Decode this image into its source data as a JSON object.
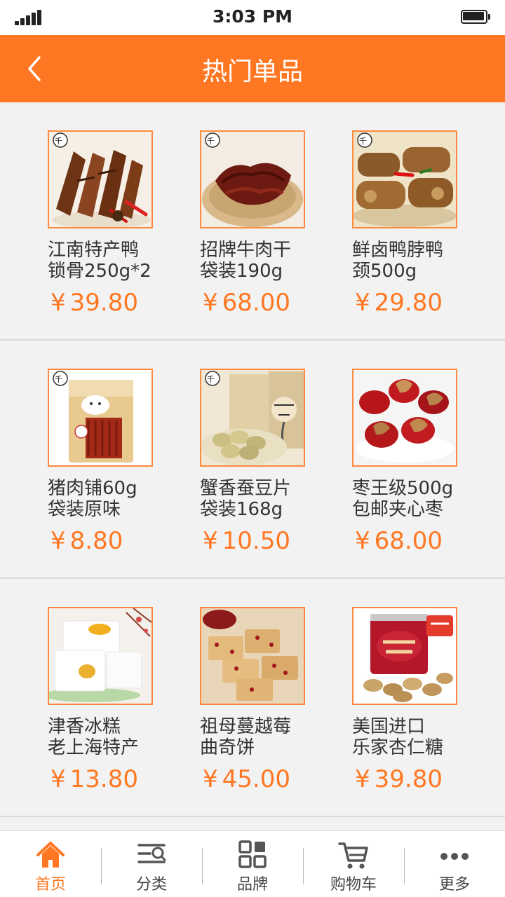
{
  "status_bar": {
    "time": "3:03 PM"
  },
  "header": {
    "title": "热门单品"
  },
  "currency_symbol": "¥",
  "products": [
    {
      "name_line1": "江南特产鸭",
      "name_line2": "锁骨250g*2",
      "price": "39.80",
      "image": "duck-neck-bone"
    },
    {
      "name_line1": "招牌牛肉干",
      "name_line2": "袋装190g",
      "price": "68.00",
      "image": "beef-jerky"
    },
    {
      "name_line1": "鲜卤鸭脖鸭",
      "name_line2": "颈500g",
      "price": "29.80",
      "image": "braised-duck-neck"
    },
    {
      "name_line1": "猪肉铺60g",
      "name_line2": "袋装原味",
      "price": "8.80",
      "image": "pork-jerky-bag"
    },
    {
      "name_line1": "蟹香蚕豆片",
      "name_line2": "袋装168g",
      "price": "10.50",
      "image": "broad-bean-chips"
    },
    {
      "name_line1": "枣王级500g",
      "name_line2": "包邮夹心枣",
      "price": "68.00",
      "image": "walnut-dates"
    },
    {
      "name_line1": "津香冰糕",
      "name_line2": "老上海特产",
      "price": "13.80",
      "image": "rice-cake"
    },
    {
      "name_line1": "祖母蔓越莓",
      "name_line2": "曲奇饼",
      "price": "45.00",
      "image": "cranberry-cookies"
    },
    {
      "name_line1": "美国进口",
      "name_line2": "乐家杏仁糖",
      "price": "39.80",
      "image": "almond-roca"
    }
  ],
  "tab_bar": [
    {
      "label": "首页",
      "icon": "home-icon",
      "active": true
    },
    {
      "label": "分类",
      "icon": "category-search-icon",
      "active": false
    },
    {
      "label": "品牌",
      "icon": "grid-icon",
      "active": false
    },
    {
      "label": "购物车",
      "icon": "cart-icon",
      "active": false
    },
    {
      "label": "更多",
      "icon": "more-dots-icon",
      "active": false
    }
  ],
  "colors": {
    "accent": "#ff7722",
    "price": "#ff7722",
    "background": "#f2f2f2"
  }
}
